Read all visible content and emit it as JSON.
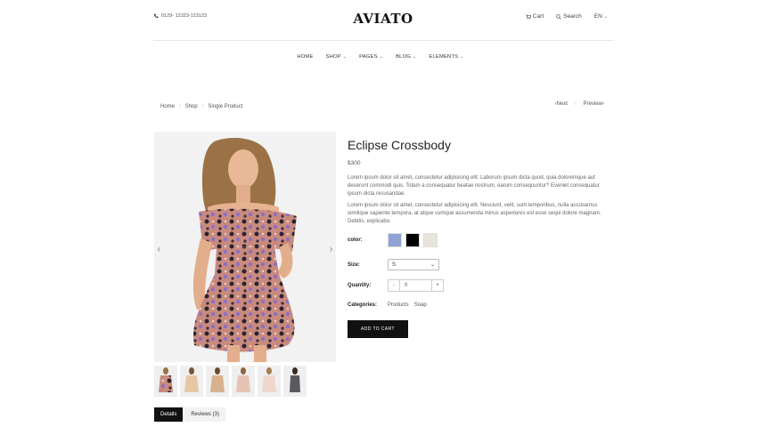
{
  "header": {
    "phone": "0129- 12323-123123",
    "logo": "AVIATO",
    "cart_label": "Cart",
    "search_label": "Search",
    "language": "EN"
  },
  "nav": {
    "items": [
      {
        "label": "HOME",
        "has_dropdown": false
      },
      {
        "label": "SHOP",
        "has_dropdown": true
      },
      {
        "label": "PAGES",
        "has_dropdown": true
      },
      {
        "label": "BLOG",
        "has_dropdown": true
      },
      {
        "label": "ELEMENTS",
        "has_dropdown": true
      }
    ]
  },
  "breadcrumb": [
    "Home",
    "Shop",
    "Single Product"
  ],
  "pager": {
    "prev": "Next",
    "next": "Preview"
  },
  "product": {
    "title": "Eclipse Crossbody",
    "price": "$300",
    "description": [
      "Lorem ipsum dolor sit amet, consectetur adipisicing elit. Laborum ipsum dicta quod, quia doloremque aut deserunt commodi quis. Totam a consequatur beatae nostrum, earum consequuntur? Eveniet consequatur ipsum dicta recusandae.",
      "Lorem ipsum dolor sit amet, consectetur adipisicing elit. Nesciunt, velit, sunt temporibus, nulla accusamus similique sapiente tempora, at atque cumque assumenda minus asperiores est esse sequi dolore magnam. Debitis, explicabo."
    ],
    "color_label": "color:",
    "colors": [
      "#8fa3d4",
      "#000000",
      "#e8e4d8"
    ],
    "size_label": "Size:",
    "size_value": "S",
    "quantity_label": "Quantity:",
    "quantity_value": "0",
    "minus": "-",
    "plus": "+",
    "categories_label": "Categories:",
    "categories": [
      "Products",
      "Soap"
    ],
    "add_to_cart": "ADD TO CART"
  },
  "tabs": [
    {
      "label": "Details",
      "active": true
    },
    {
      "label": "Reviews (3)",
      "active": false
    }
  ]
}
